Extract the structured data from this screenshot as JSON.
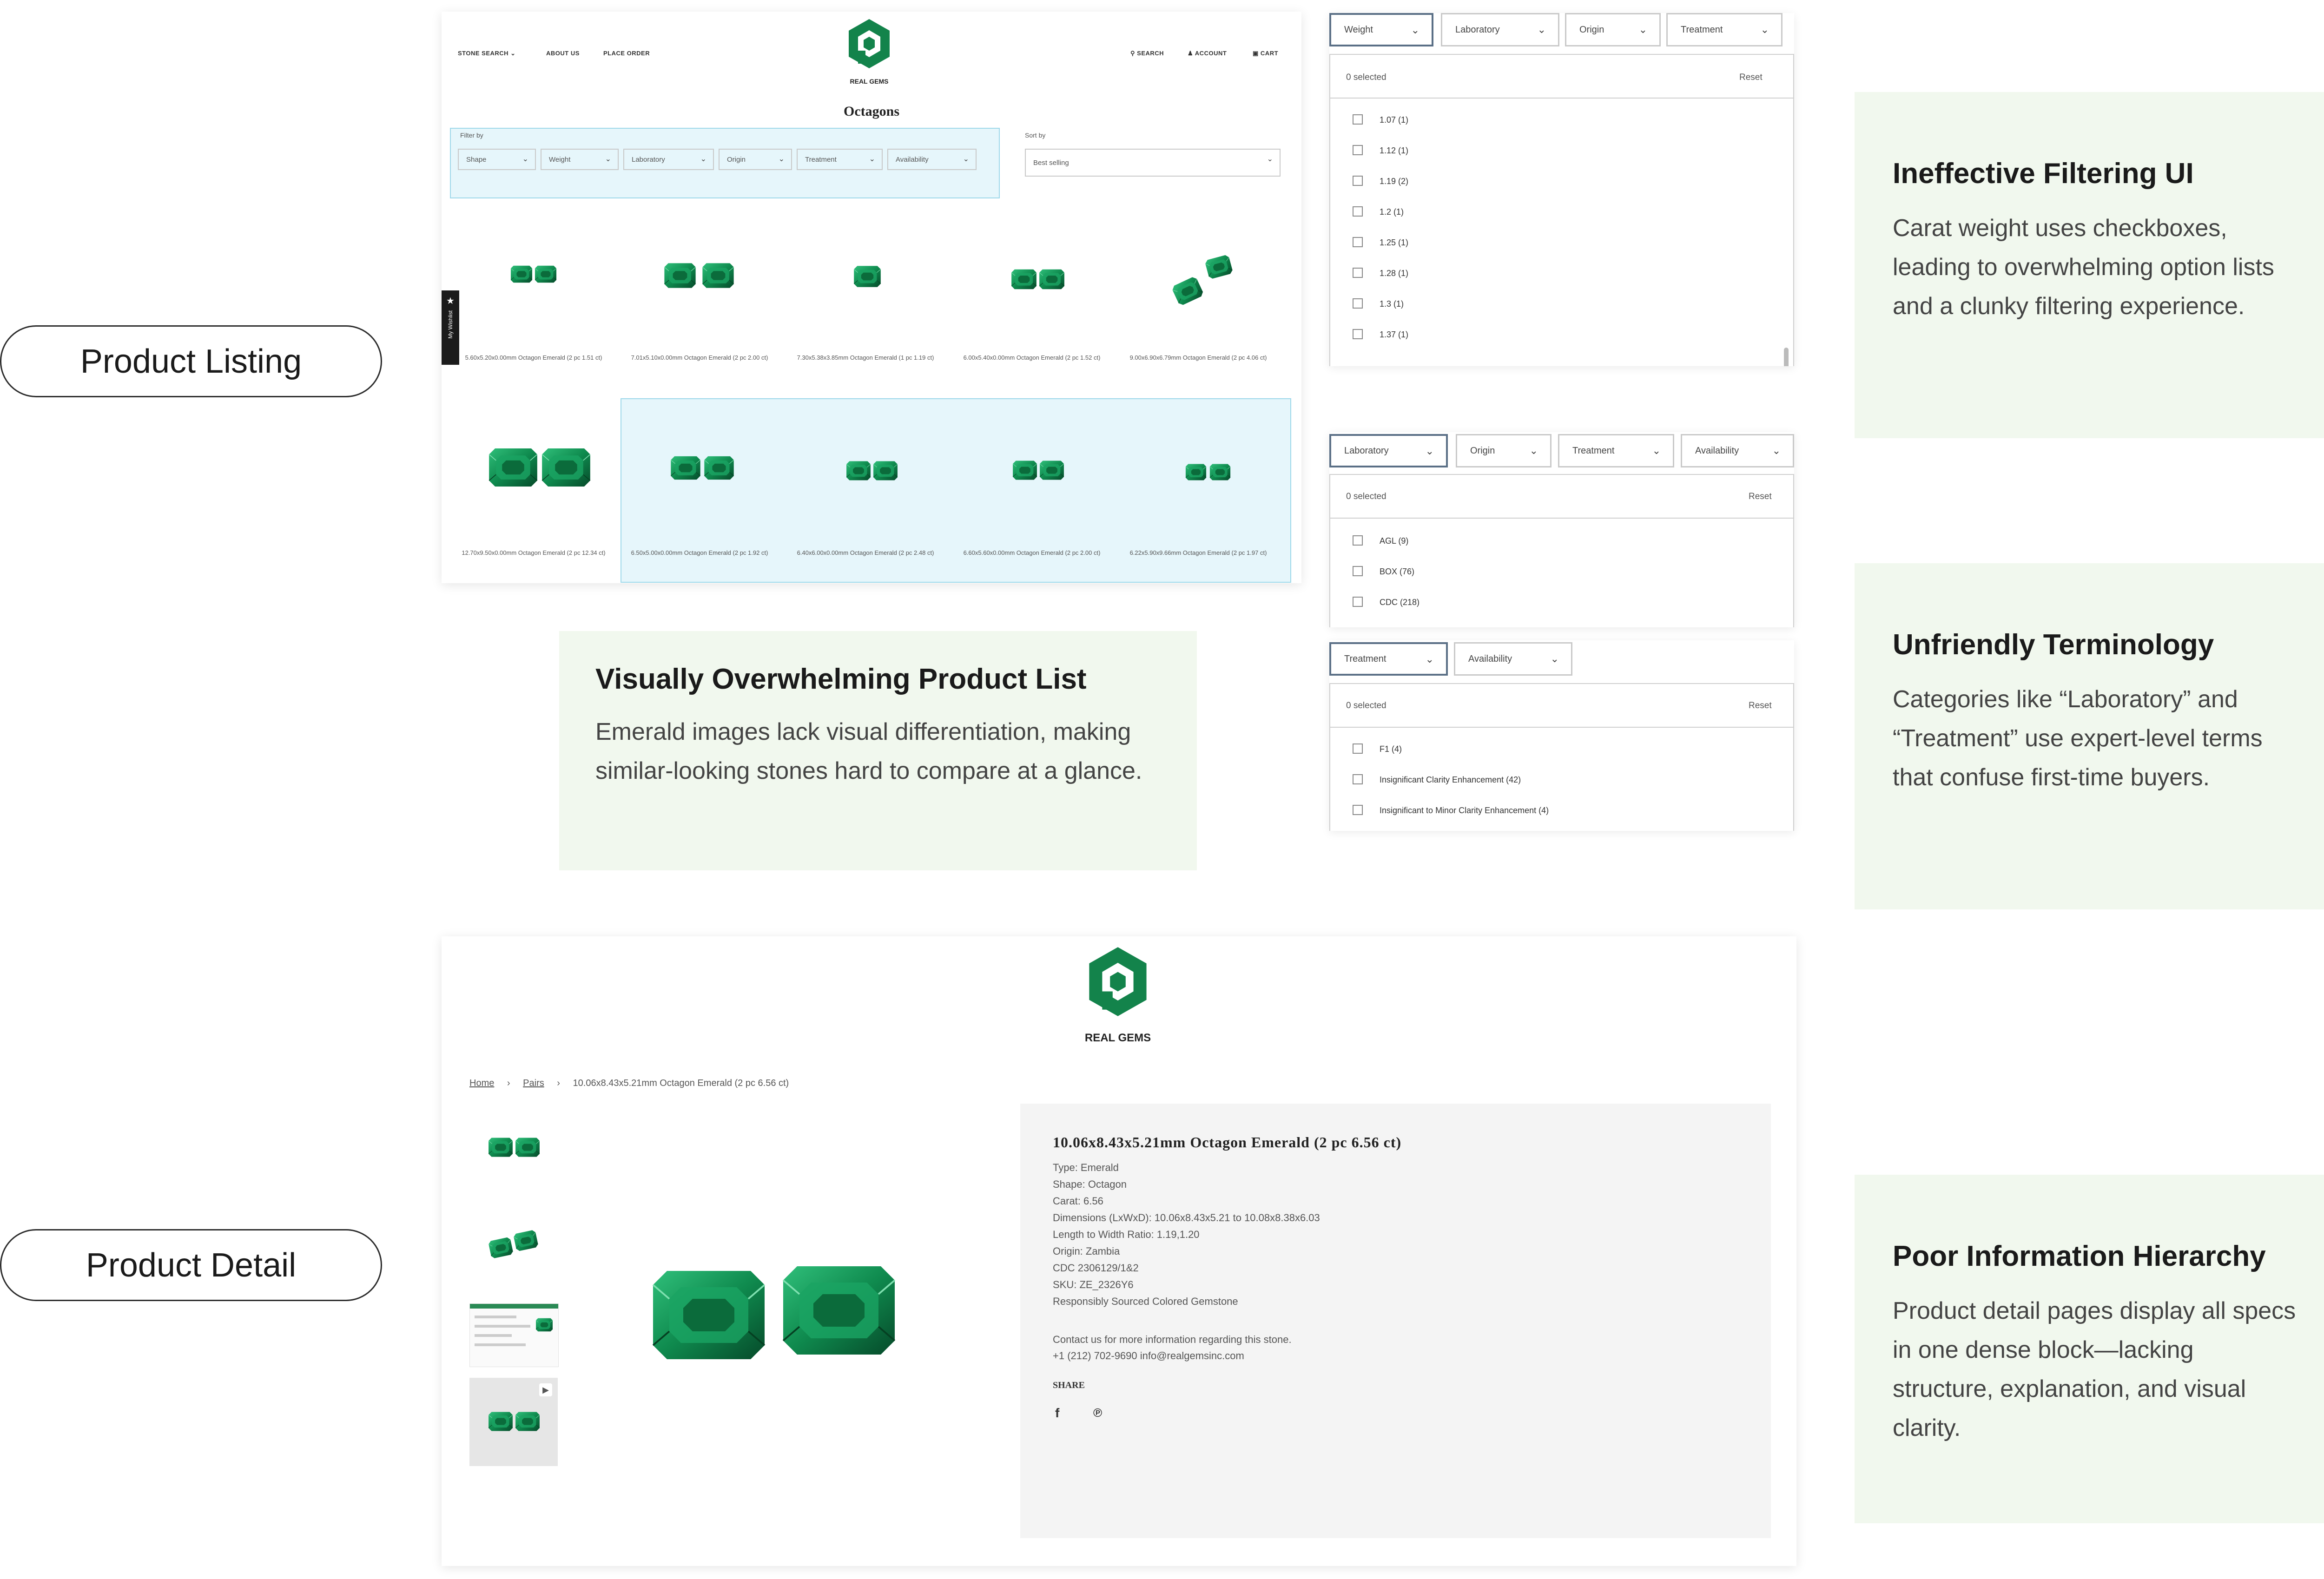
{
  "labels": {
    "product_listing": "Product Listing",
    "product_detail": "Product Detail"
  },
  "listing": {
    "nav": {
      "stone_search": "STONE SEARCH",
      "about": "ABOUT US",
      "place_order": "PLACE ORDER",
      "search": "SEARCH",
      "account": "ACCOUNT",
      "cart": "CART"
    },
    "brand": "REAL GEMS",
    "title": "Octagons",
    "filter_by": "Filter by",
    "filters": [
      "Shape",
      "Weight",
      "Laboratory",
      "Origin",
      "Treatment",
      "Availability"
    ],
    "sort_by": "Sort by",
    "sort_value": "Best selling",
    "wishlist": "My Wishlist",
    "products": [
      {
        "caption": "5.60x5.20x0.00mm Octagon Emerald (2 pc 1.51 ct)"
      },
      {
        "caption": "7.01x5.10x0.00mm Octagon Emerald (2 pc 2.00 ct)"
      },
      {
        "caption": "7.30x5.38x3.85mm Octagon Emerald (1 pc 1.19 ct)"
      },
      {
        "caption": "6.00x5.40x0.00mm Octagon Emerald (2 pc 1.52 ct)"
      },
      {
        "caption": "9.00x6.90x6.79mm Octagon Emerald (2 pc 4.06 ct)"
      },
      {
        "caption": "12.70x9.50x0.00mm Octagon Emerald (2 pc 12.34 ct)"
      },
      {
        "caption": "6.50x5.00x0.00mm Octagon Emerald (2 pc 1.92 ct)"
      },
      {
        "caption": "6.40x6.00x0.00mm Octagon Emerald (2 pc 2.48 ct)"
      },
      {
        "caption": "6.60x5.60x0.00mm Octagon Emerald (2 pc 2.00 ct)"
      },
      {
        "caption": "6.22x5.90x9.66mm Octagon Emerald (2 pc 1.97 ct)"
      }
    ]
  },
  "weight_panel": {
    "tabs": [
      "Weight",
      "Laboratory",
      "Origin",
      "Treatment"
    ],
    "selected": "0 selected",
    "reset": "Reset",
    "options": [
      "1.07 (1)",
      "1.12 (1)",
      "1.19 (2)",
      "1.2 (1)",
      "1.25 (1)",
      "1.28 (1)",
      "1.3 (1)",
      "1.37 (1)"
    ]
  },
  "lab_panel": {
    "tabs": [
      "Laboratory",
      "Origin",
      "Treatment",
      "Availability"
    ],
    "selected": "0 selected",
    "reset": "Reset",
    "options": [
      "AGL (9)",
      "BOX (76)",
      "CDC (218)"
    ]
  },
  "treatment_panel": {
    "tabs": [
      "Treatment",
      "Availability"
    ],
    "selected": "0 selected",
    "reset": "Reset",
    "options": [
      "F1 (4)",
      "Insignificant Clarity Enhancement (42)",
      "Insignificant to Minor Clarity Enhancement (4)"
    ]
  },
  "notes": {
    "filtering": {
      "title": "Ineffective Filtering UI",
      "body": "Carat weight uses checkboxes, leading to overwhelming option lists and a clunky filtering experience."
    },
    "terminology": {
      "title": "Unfriendly Terminology",
      "body": "Categories like “Laboratory” and “Treatment” use expert-level terms that confuse first-time buyers."
    },
    "overwhelming": {
      "title": "Visually Overwhelming Product List",
      "body": "Emerald images lack visual differentiation, making similar-looking stones hard to compare at a glance."
    },
    "hierarchy": {
      "title": "Poor Information Hierarchy",
      "body": "Product detail pages display all specs in one dense block—lacking structure, explanation, and visual clarity."
    }
  },
  "detail": {
    "brand": "REAL GEMS",
    "breadcrumb": {
      "home": "Home",
      "pairs": "Pairs",
      "current": "10.06x8.43x5.21mm Octagon Emerald (2 pc 6.56 ct)"
    },
    "title": "10.06x8.43x5.21mm Octagon Emerald (2 pc 6.56 ct)",
    "specs": [
      "Type: Emerald",
      "Shape: Octagon",
      "Carat: 6.56",
      "Dimensions (LxWxD): 10.06x8.43x5.21 to 10.08x8.38x6.03",
      "Length to Width Ratio: 1.19,1.20",
      "Origin: Zambia",
      "CDC 2306129/1&2",
      "SKU: ZE_2326Y6",
      "Responsibly Sourced Colored Gemstone"
    ],
    "contact": "Contact us for more information regarding this stone.",
    "phone": "+1 (212) 702-9690 info@realgemsinc.com",
    "share": "SHARE"
  },
  "colors": {
    "emerald": "#0f8a4e",
    "emerald_dark": "#0a5c34",
    "note_bg": "#f1f8ee",
    "highlight": "#e6f6fb"
  }
}
